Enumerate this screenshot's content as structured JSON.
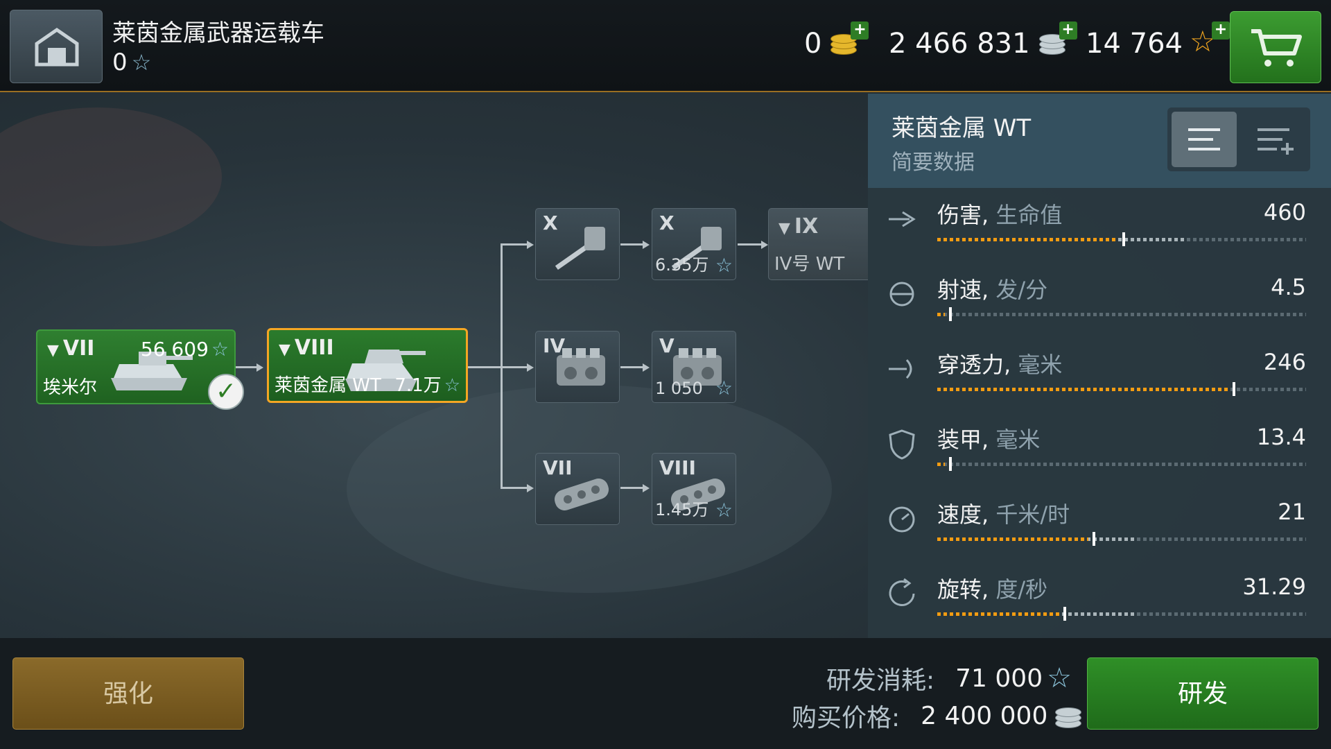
{
  "header": {
    "vehicle_title": "莱茵金属武器运载车",
    "vehicle_xp": "0",
    "gold": "0",
    "credits": "2 466 831",
    "free_xp": "14 764"
  },
  "tree": {
    "prev_vehicle": {
      "tier": "VII",
      "name": "埃米尔",
      "xp": "56 609"
    },
    "current_vehicle": {
      "tier": "VIII",
      "name": "莱茵金属 WT",
      "cost": "7.1万"
    },
    "next_vehicle": {
      "tier": "IX",
      "name": "IV号 WT"
    },
    "modules": {
      "gun_1": {
        "tier": "X",
        "icon": "gun-icon"
      },
      "gun_2": {
        "tier": "X",
        "cost": "6.35万",
        "icon": "gun-icon"
      },
      "engine_1": {
        "tier": "IV",
        "icon": "engine-icon"
      },
      "engine_2": {
        "tier": "V",
        "cost": "1 050",
        "icon": "engine-icon"
      },
      "tracks_1": {
        "tier": "VII",
        "icon": "tracks-icon"
      },
      "tracks_2": {
        "tier": "VIII",
        "cost": "1.45万",
        "icon": "tracks-icon"
      }
    }
  },
  "panel": {
    "title": "莱茵金属 WT",
    "subtitle": "简要数据",
    "stats": [
      {
        "label": "伤害",
        "unit": "生命值",
        "value": "460",
        "fill": 0.49,
        "range": 0.67,
        "icon": "damage-icon"
      },
      {
        "label": "射速",
        "unit": "发/分",
        "value": "4.5",
        "fill": 0.02,
        "range": 0.02,
        "icon": "rate-of-fire-icon"
      },
      {
        "label": "穿透力",
        "unit": "毫米",
        "value": "246",
        "fill": 0.79,
        "range": 0.79,
        "icon": "penetration-icon"
      },
      {
        "label": "装甲",
        "unit": "毫米",
        "value": "13.4",
        "fill": 0.02,
        "range": 0.02,
        "icon": "armor-icon"
      },
      {
        "label": "速度",
        "unit": "千米/时",
        "value": "21",
        "fill": 0.41,
        "range": 0.54,
        "icon": "speed-icon"
      },
      {
        "label": "旋转",
        "unit": "度/秒",
        "value": "31.29",
        "fill": 0.33,
        "range": 0.54,
        "icon": "traverse-icon"
      }
    ]
  },
  "bottom": {
    "upgrade_label": "强化",
    "research_cost_label": "研发消耗:",
    "research_cost": "71 000",
    "purchase_price_label": "购买价格:",
    "purchase_price": "2 400 000",
    "research_label": "研发"
  },
  "colors": {
    "accent_orange": "#f39c12",
    "researched_green": "#2f7f30",
    "button_green": "#2f8f27",
    "upgrade_gold": "#8a6a2a"
  }
}
